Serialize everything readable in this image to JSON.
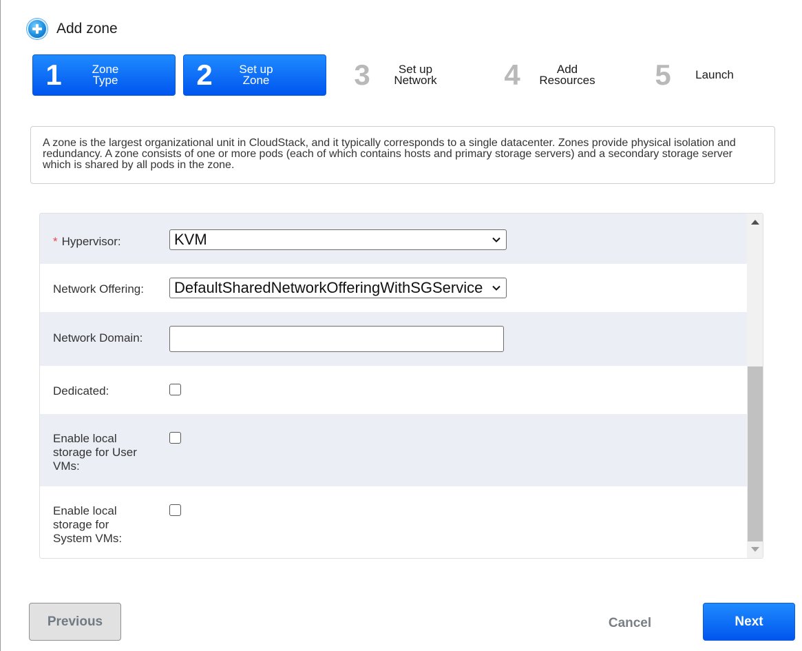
{
  "header": {
    "title": "Add zone",
    "icon": "add-circle-icon"
  },
  "steps": [
    {
      "num": "1",
      "line1": "Zone",
      "line2": "Type",
      "active": true
    },
    {
      "num": "2",
      "line1": "Set up",
      "line2": "Zone",
      "active": true
    },
    {
      "num": "3",
      "line1": "Set up",
      "line2": "Network",
      "active": false
    },
    {
      "num": "4",
      "line1": "Add",
      "line2": "Resources",
      "active": false
    },
    {
      "num": "5",
      "line1": "Launch",
      "line2": "",
      "active": false
    }
  ],
  "description": "A zone is the largest organizational unit in CloudStack, and it typically corresponds to a single datacenter. Zones provide physical isolation and redundancy. A zone consists of one or more pods (each of which contains hosts and primary storage servers) and a secondary storage server which is shared by all pods in the zone.",
  "form": {
    "required_marker": "*",
    "hypervisor": {
      "label": "Hypervisor:",
      "value": "KVM"
    },
    "network_offering": {
      "label": "Network Offering:",
      "value": "DefaultSharedNetworkOfferingWithSGService"
    },
    "network_domain": {
      "label": "Network Domain:",
      "value": ""
    },
    "dedicated": {
      "label": "Dedicated:",
      "checked": false
    },
    "local_storage_user": {
      "label_lines": [
        "Enable local",
        "storage for User",
        "VMs:"
      ],
      "checked": false
    },
    "local_storage_system": {
      "label_lines": [
        "Enable local",
        "storage for",
        "System VMs:"
      ],
      "checked": false
    }
  },
  "footer": {
    "previous": "Previous",
    "cancel": "Cancel",
    "next": "Next"
  },
  "colors": {
    "accent": "#0a6cff",
    "row_shade": "#ebeef5",
    "required": "#e5484d"
  }
}
